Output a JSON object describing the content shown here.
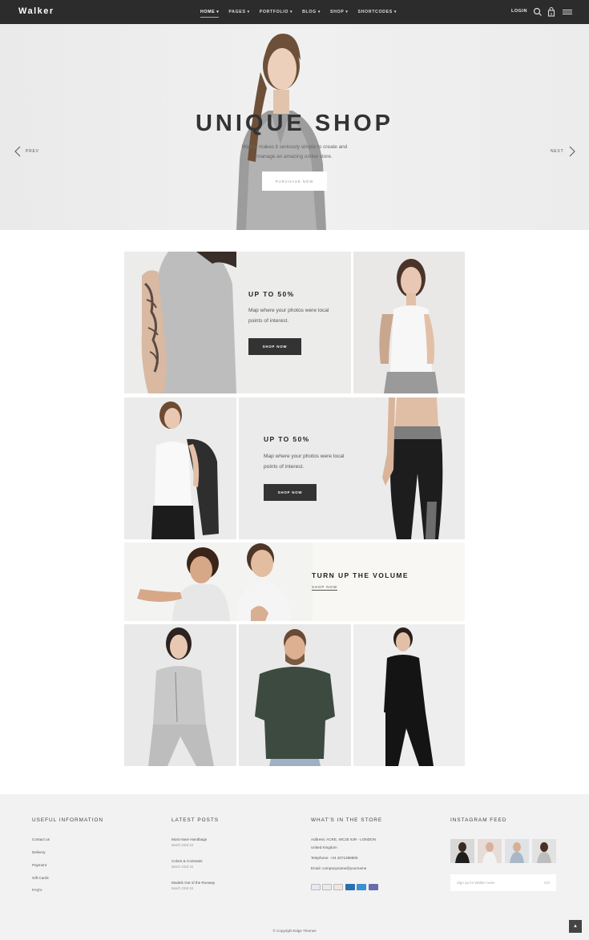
{
  "header": {
    "logo": "Walker",
    "nav": [
      {
        "label": "HOME",
        "active": true
      },
      {
        "label": "PAGES",
        "active": false
      },
      {
        "label": "PORTFOLIO",
        "active": false
      },
      {
        "label": "BLOG",
        "active": false
      },
      {
        "label": "SHOP",
        "active": false
      },
      {
        "label": "SHORTCODES",
        "active": false
      }
    ],
    "login": "LOGIN",
    "icons": [
      "search-icon",
      "cart-icon",
      "menu-icon"
    ]
  },
  "hero": {
    "title": "UNIQUE SHOP",
    "subtitle_line1": "Walker makes it seriously simple to create and",
    "subtitle_line2": "manage an amazing online store.",
    "button": "PURCHASE NOW",
    "prev": "PREV",
    "next": "NEXT",
    "slides": 3,
    "active_slide": 1
  },
  "promos": [
    {
      "title": "UP TO 50%",
      "text": "Map where your photos were local points of interest.",
      "button": "SHOP NOW"
    },
    {
      "title": "UP TO 50%",
      "text": "Map where your photos were local points of interest.",
      "button": "SHOP NOW"
    },
    {
      "title": "TURN UP THE VOLUME",
      "button": "SHOP NOW"
    }
  ],
  "footer": {
    "useful": {
      "title": "USEFUL INFORMATION",
      "links": [
        "Contact us",
        "Delivery",
        "Payment",
        "Gift Cards",
        "FAQ's"
      ]
    },
    "posts": {
      "title": "LATEST POSTS",
      "items": [
        {
          "title": "Must Have Handbags",
          "date": "March 23rd 16"
        },
        {
          "title": "Colors & Contrasts",
          "date": "March 23rd 16"
        },
        {
          "title": "Models Out of the Runway",
          "date": "March 23rd 16"
        }
      ]
    },
    "store": {
      "title": "WHAT'S IN THE STORE",
      "address1": "Address: ACRE, WC2E 9JR - LONDON",
      "address2": "United Kingdom",
      "phone": "Telephone: +44 2071389900",
      "email": "Email: companyname@yourname"
    },
    "instagram": {
      "title": "INSTAGRAM FEED",
      "newsletter_placeholder": "Sign up for Walker news",
      "newsletter_button": "GO"
    },
    "copyright": "© Copyright Edge Themes"
  },
  "colors": {
    "header_bg": "#2c2c2c",
    "dark_button": "#333333",
    "footer_bg": "#f2f2f2"
  }
}
